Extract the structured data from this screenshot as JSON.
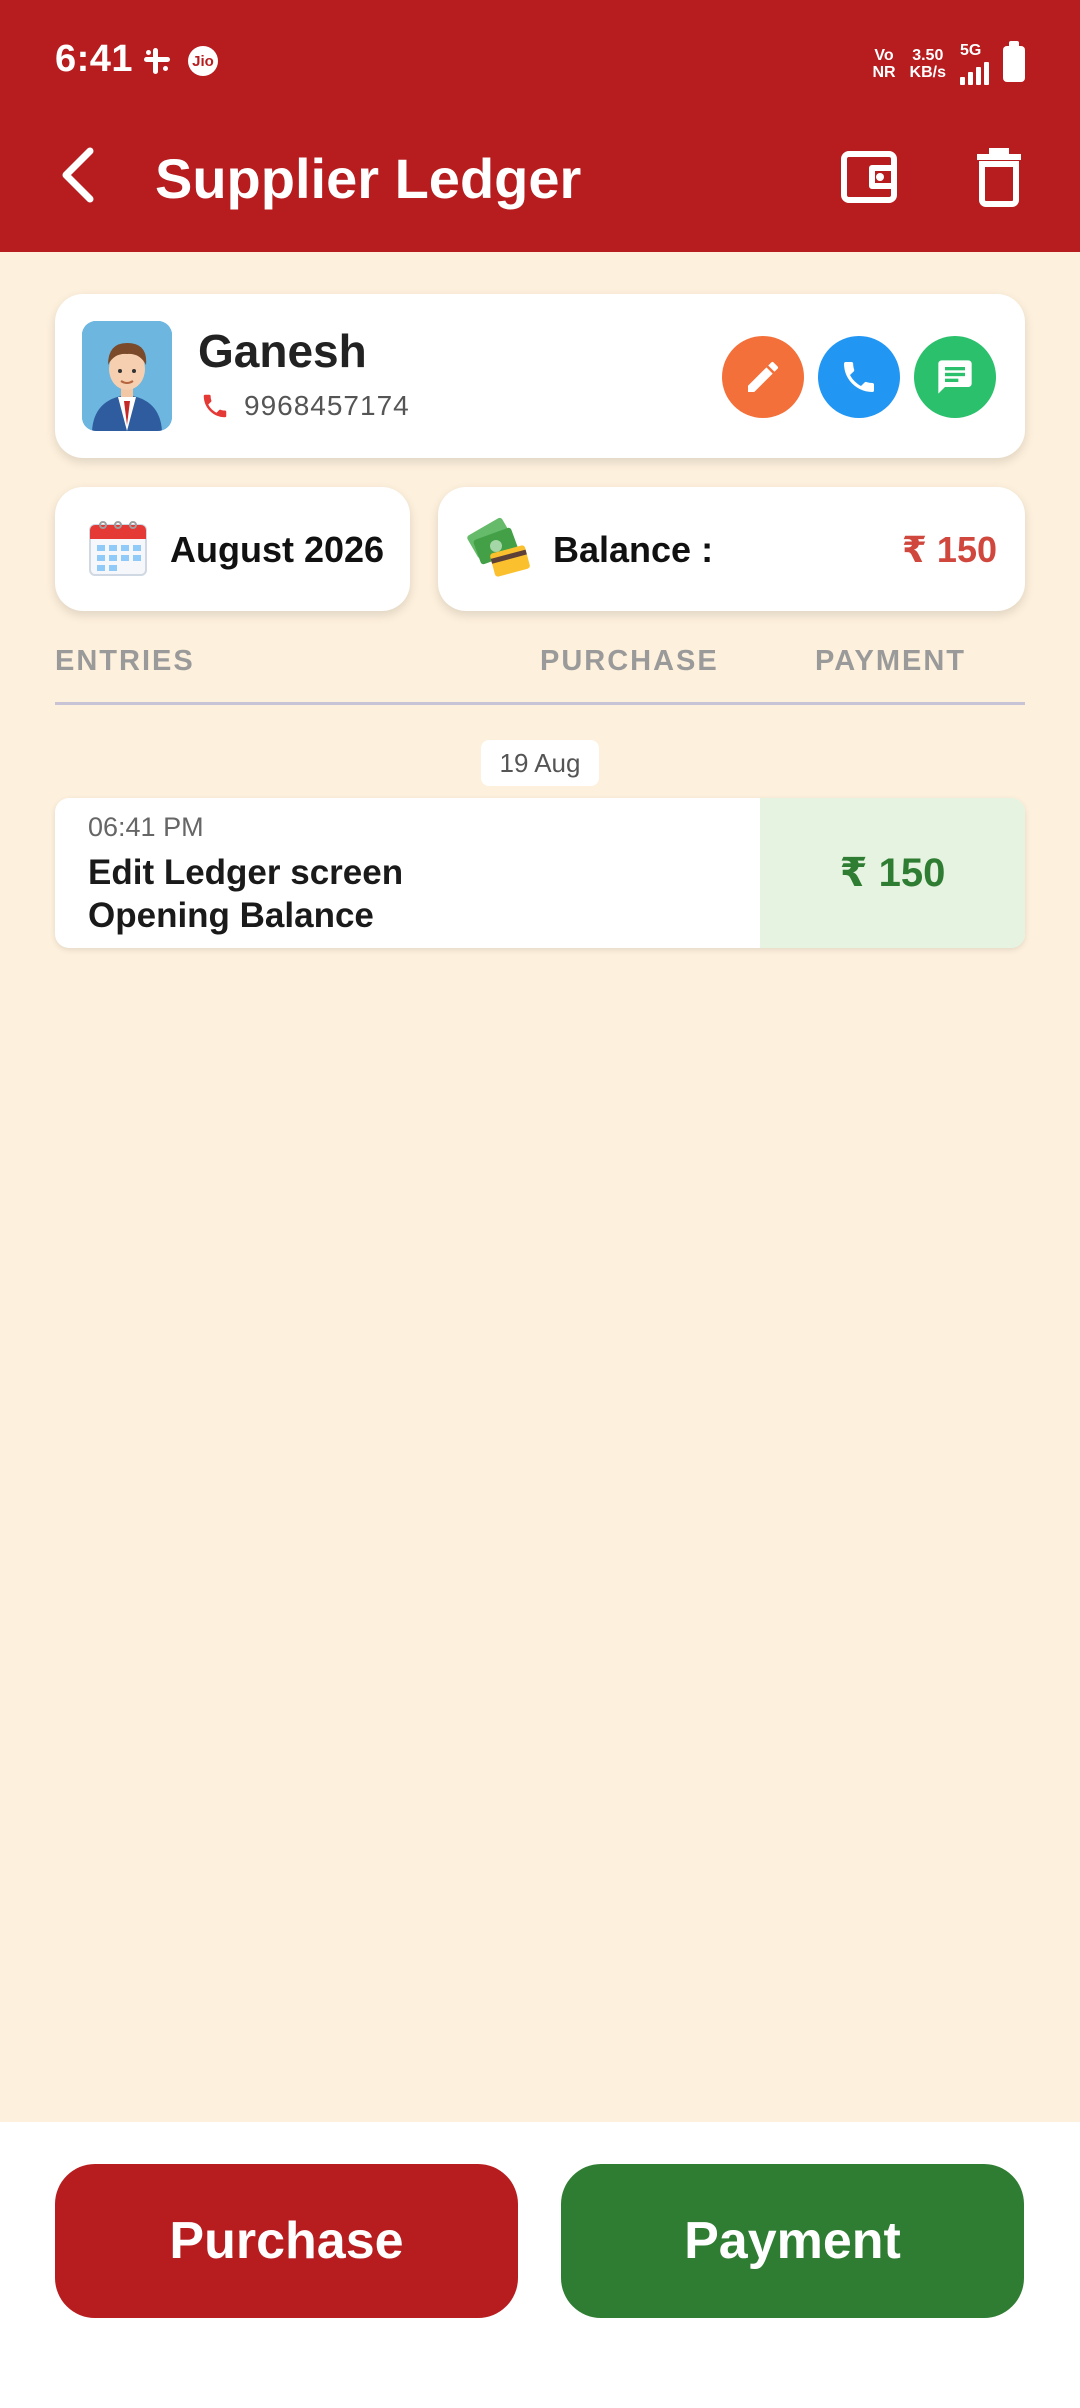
{
  "status_bar": {
    "time": "6:41",
    "carrier": "Jio",
    "volte_top": "Vo",
    "volte_bottom": "NR",
    "speed_value": "3.50",
    "speed_unit": "KB/s",
    "network": "5G"
  },
  "appbar": {
    "title": "Supplier Ledger",
    "back_icon": "back-arrow-icon",
    "wallet_icon": "wallet-icon",
    "delete_icon": "trash-icon"
  },
  "contact": {
    "name": "Ganesh",
    "phone": "9968457174",
    "actions": {
      "edit_color": "#F4703A",
      "call_color": "#2196F3",
      "message_color": "#2BC06B"
    }
  },
  "period": {
    "month": "August 2026"
  },
  "balance": {
    "label": "Balance :",
    "value": "₹ 150",
    "color": "#D0473D"
  },
  "columns": {
    "entries": "ENTRIES",
    "purchase": "PURCHASE",
    "payment": "PAYMENT"
  },
  "groups": [
    {
      "date": "19 Aug",
      "entries": [
        {
          "time": "06:41 PM",
          "title_line1": "Edit Ledger screen",
          "title_line2": "Opening Balance",
          "purchase": "",
          "payment": "₹ 150"
        }
      ]
    }
  ],
  "actions": {
    "purchase_label": "Purchase",
    "payment_label": "Payment",
    "purchase_color": "#B71C1F",
    "payment_color": "#2E7D32"
  }
}
